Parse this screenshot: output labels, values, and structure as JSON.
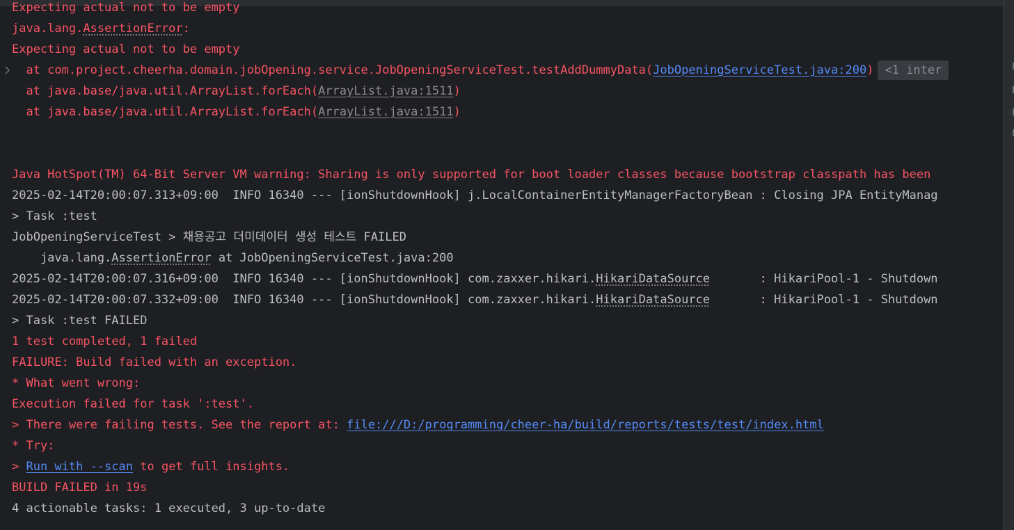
{
  "lines": [
    {
      "text": "Expecting actual not to be empty"
    },
    {
      "pre": "java.lang.",
      "link": "AssertionError",
      "post": ":"
    },
    {
      "text": "Expecting actual not to be empty"
    },
    {
      "pre": "  at com.project.cheerha.domain.jobOpening.service.JobOpeningServiceTest.testAddDummyData(",
      "link": "JobOpeningServiceTest.java:200",
      "post": ")",
      "badge": "<1 inter"
    },
    {
      "pre": "  at java.base/java.util.ArrayList.forEach(",
      "link": "ArrayList.java:1511",
      "post": ")"
    },
    {
      "pre": "  at java.base/java.util.ArrayList.forEach(",
      "link": "ArrayList.java:1511",
      "post": ")"
    },
    {
      "text": "Java HotSpot(TM) 64-Bit Server VM warning: Sharing is only supported for boot loader classes because bootstrap classpath has been"
    },
    {
      "text": "2025-02-14T20:00:07.313+09:00  INFO 16340 --- [ionShutdownHook] j.LocalContainerEntityManagerFactoryBean : Closing JPA EntityManag"
    },
    {
      "text": "> Task :test"
    },
    {
      "text": "JobOpeningServiceTest > 채용공고 더미데이터 생성 테스트 FAILED"
    },
    {
      "pre": "    java.lang.",
      "link": "AssertionError",
      "post": " at JobOpeningServiceTest.java:200"
    },
    {
      "pre": "2025-02-14T20:00:07.316+09:00  INFO 16340 --- [ionShutdownHook] com.zaxxer.hikari.",
      "link": "HikariDataSource",
      "post": "       : HikariPool-1 - Shutdown"
    },
    {
      "pre": "2025-02-14T20:00:07.332+09:00  INFO 16340 --- [ionShutdownHook] com.zaxxer.hikari.",
      "link": "HikariDataSource",
      "post": "       : HikariPool-1 - Shutdown"
    },
    {
      "text": "> Task :test FAILED"
    },
    {
      "text": "1 test completed, 1 failed"
    },
    {
      "text": "FAILURE: Build failed with an exception."
    },
    {
      "text": "* What went wrong:"
    },
    {
      "text": "Execution failed for task ':test'."
    },
    {
      "pre": "> There were failing tests. See the report at: ",
      "link": "file:///D:/programming/cheer-ha/build/reports/tests/test/index.html"
    },
    {
      "text": "* Try:"
    },
    {
      "pre": "> ",
      "link": "Run with --scan",
      "post": " to get full insights."
    },
    {
      "text": "BUILD FAILED in 19s"
    },
    {
      "text": "4 actionable tasks: 1 executed, 3 up-to-date"
    }
  ],
  "icons": {
    "fold": "chevron-right-icon"
  },
  "colors": {
    "background": "#1e1f22",
    "error": "#f75464",
    "normal": "#bcbec4",
    "link": "#548af7",
    "muted_link": "#8c8c8c"
  }
}
